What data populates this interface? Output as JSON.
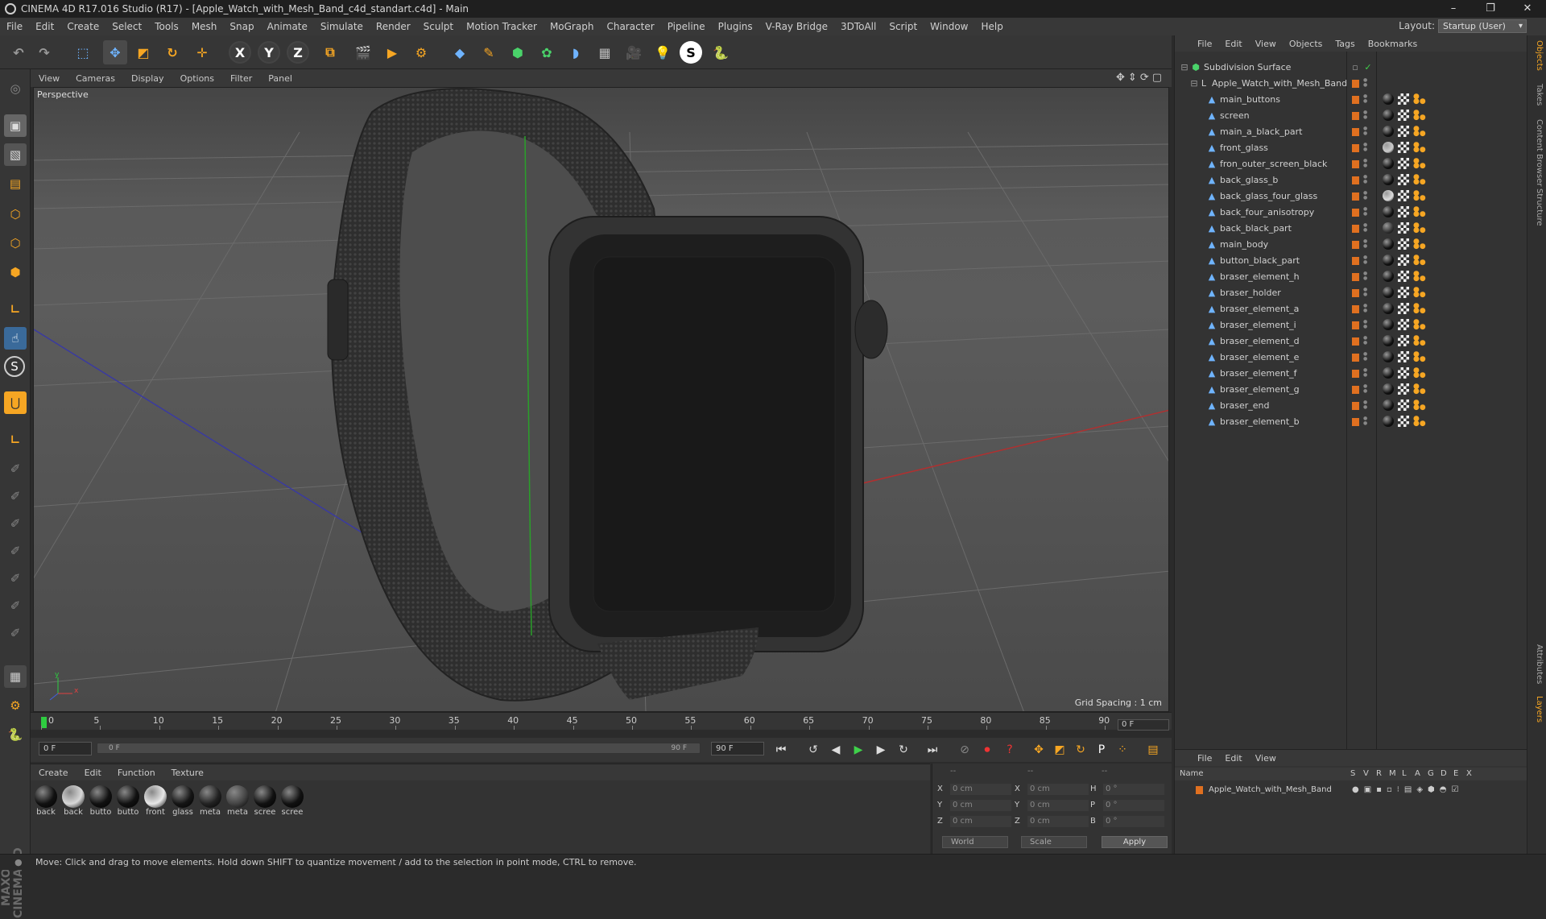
{
  "window": {
    "title": "CINEMA 4D R17.016 Studio (R17) - [Apple_Watch_with_Mesh_Band_c4d_standart.c4d] - Main",
    "controls": [
      "–",
      "❐",
      "✕"
    ]
  },
  "menubar": [
    "File",
    "Edit",
    "Create",
    "Select",
    "Tools",
    "Mesh",
    "Snap",
    "Animate",
    "Simulate",
    "Render",
    "Sculpt",
    "Motion Tracker",
    "MoGraph",
    "Character",
    "Pipeline",
    "Plugins",
    "V-Ray Bridge",
    "3DToAll",
    "Script",
    "Window",
    "Help"
  ],
  "layout": {
    "label": "Layout:",
    "value": "Startup (User)"
  },
  "viewport": {
    "menu": [
      "View",
      "Cameras",
      "Display",
      "Options",
      "Filter",
      "Panel"
    ],
    "label": "Perspective",
    "grid_spacing": "Grid Spacing : 1 cm",
    "axis_labels": {
      "y": "y",
      "x": "x",
      "z": "z"
    }
  },
  "timeline": {
    "ticks": [
      "0",
      "5",
      "10",
      "15",
      "20",
      "25",
      "30",
      "35",
      "40",
      "45",
      "50",
      "55",
      "60",
      "65",
      "70",
      "75",
      "80",
      "85",
      "90"
    ],
    "end_field": "0 F"
  },
  "playback": {
    "current": "0 F",
    "slider_start": "0 F",
    "slider_end": "90 F",
    "max": "90 F"
  },
  "materials": {
    "menu": [
      "Create",
      "Edit",
      "Function",
      "Texture"
    ],
    "items": [
      {
        "label": "back",
        "color": "#111"
      },
      {
        "label": "back",
        "color": "#d8d8d8"
      },
      {
        "label": "butto",
        "color": "#111"
      },
      {
        "label": "butto",
        "color": "#111"
      },
      {
        "label": "front",
        "color": "#e8e8e8"
      },
      {
        "label": "glass",
        "color": "#151515"
      },
      {
        "label": "meta",
        "color": "#222"
      },
      {
        "label": "meta",
        "color": "#444"
      },
      {
        "label": "scree",
        "color": "#111"
      },
      {
        "label": "scree",
        "color": "#111"
      }
    ]
  },
  "coords": {
    "header": [
      "--",
      "--",
      "--"
    ],
    "rows": [
      {
        "a": "X",
        "av": "0 cm",
        "b": "X",
        "bv": "0 cm",
        "c": "H",
        "cv": "0 °"
      },
      {
        "a": "Y",
        "av": "0 cm",
        "b": "Y",
        "bv": "0 cm",
        "c": "P",
        "cv": "0 °"
      },
      {
        "a": "Z",
        "av": "0 cm",
        "b": "Z",
        "bv": "0 cm",
        "c": "B",
        "cv": "0 °"
      }
    ],
    "world": "World",
    "scale": "Scale",
    "apply": "Apply"
  },
  "objects": {
    "menu": [
      "File",
      "Edit",
      "View",
      "Objects",
      "Tags",
      "Bookmarks"
    ],
    "root": "Subdivision Surface",
    "group": "Apple_Watch_with_Mesh_Band",
    "items": [
      "main_buttons",
      "screen",
      "main_a_black_part",
      "front_glass",
      "fron_outer_screen_black",
      "back_glass_b",
      "back_glass_four_glass",
      "back_four_anisotropy",
      "back_black_part",
      "main_body",
      "button_black_part",
      "braser_element_h",
      "braser_holder",
      "braser_element_a",
      "braser_element_i",
      "braser_element_d",
      "braser_element_e",
      "braser_element_f",
      "braser_element_g",
      "braser_end",
      "braser_element_b"
    ]
  },
  "layers": {
    "menu": [
      "File",
      "Edit",
      "View"
    ],
    "header_name": "Name",
    "cols": [
      "S",
      "V",
      "R",
      "M",
      "L",
      "A",
      "G",
      "D",
      "E",
      "X"
    ],
    "item": "Apple_Watch_with_Mesh_Band"
  },
  "right_tabs": [
    "Objects",
    "Takes",
    "Content Browser",
    "Structure",
    "Attributes",
    "Layers"
  ],
  "status": "Move: Click and drag to move elements. Hold down SHIFT to quantize movement / add to the selection in point mode, CTRL to remove."
}
